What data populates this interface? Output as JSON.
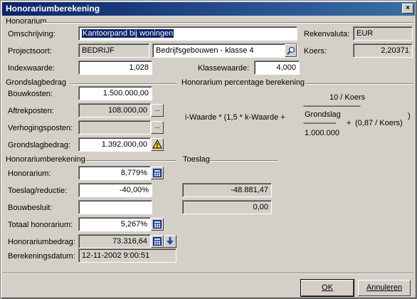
{
  "window": {
    "title": "Honorariumberekening",
    "close": "×"
  },
  "honorarium": {
    "section": "Honorarium",
    "omschrijving_label": "Omschrijving:",
    "omschrijving_value": "Kantoorpand bij woningen",
    "projectsoort_label": "Projectsoort:",
    "projectsoort_code": "BEDRIJF",
    "projectsoort_desc": "Bedrijfsgebouwen - klasse 4",
    "indexwaarde_label": "Indexwaarde:",
    "indexwaarde_value": "1,028",
    "klassewaarde_label": "Klassewaarde:",
    "klassewaarde_value": "4,000",
    "rekenvaluta_label": "Rekenvaluta:",
    "rekenvaluta_value": "EUR",
    "koers_label": "Koers:",
    "koers_value": "2,20371"
  },
  "grondslag": {
    "section": "Grondslagbedrag",
    "bouwkosten_label": "Bouwkosten:",
    "bouwkosten_value": "1.500.000,00",
    "aftrekposten_label": "Aftrekposten:",
    "aftrekposten_value": "108.000,00",
    "verhogingsposten_label": "Verhogingsposten:",
    "verhogingsposten_value": "",
    "grondslagbedrag_label": "Grondslagbedrag:",
    "grondslagbedrag_value": "1.392.000,00",
    "ellipsis": "...",
    "warning": "!"
  },
  "percentage": {
    "section": "Honorarium percentage berekening",
    "numerator": "10 / Koers",
    "dashes_top": "------------------------------",
    "main": "i-Waarde * (1,5 * k-Waarde +",
    "grondslag": "Grondslag",
    "dashes_mid": "-----------------",
    "plus": "+",
    "tail": "(0,87 / Koers)",
    "paren": ")",
    "denominator": "1.000.000"
  },
  "berekening": {
    "section": "Honorariumberekening",
    "honorarium_label": "Honorarium:",
    "honorarium_value": "8,779%",
    "toeslag_label": "Toeslag/reductie:",
    "toeslag_value": "-40,00%",
    "bouwbesluit_label": "Bouwbesluit:",
    "bouwbesluit_value": "",
    "totaal_label": "Totaal honorarium:",
    "totaal_value": "5,267%",
    "bedrag_label": "Honorariumbedrag:",
    "bedrag_value": "73.316,64",
    "datum_label": "Berekeningsdatum:",
    "datum_value": "12-11-2002 9:00:51"
  },
  "toeslag": {
    "section": "Toeslag",
    "value1": "-48.881,47",
    "value2": "0,00"
  },
  "buttons": {
    "ok": "OK",
    "annuleren": "Annuleren"
  }
}
